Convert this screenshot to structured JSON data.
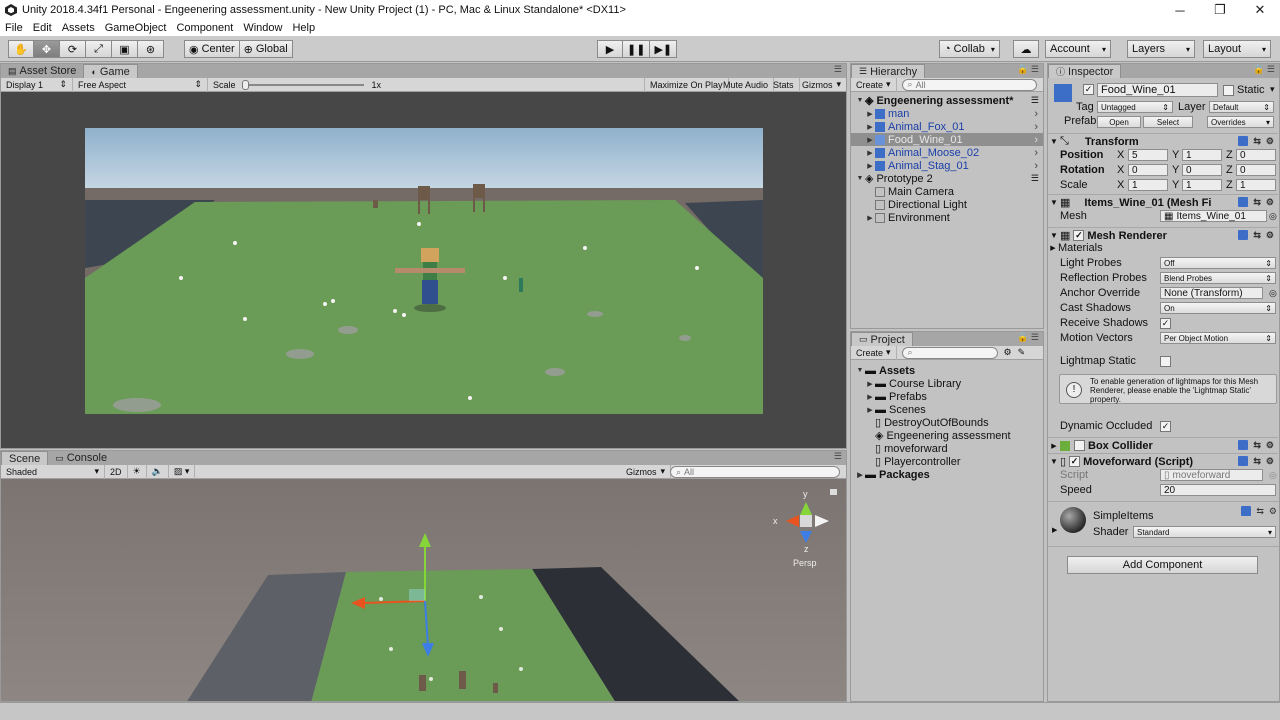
{
  "window": {
    "title": "Unity 2018.4.34f1 Personal - Engeenering assessment.unity - New Unity Project (1) - PC, Mac & Linux Standalone* <DX11>",
    "minimize": "─",
    "maximize": "❐",
    "close": "✕"
  },
  "menu": [
    "File",
    "Edit",
    "Assets",
    "GameObject",
    "Component",
    "Window",
    "Help"
  ],
  "toolbar": {
    "center_label": "Center",
    "global_label": "Global",
    "collab_label": "Collab",
    "account_label": "Account",
    "layers_label": "Layers",
    "layout_label": "Layout"
  },
  "game_panel": {
    "tabs": [
      "Asset Store",
      "Game"
    ],
    "display": "Display 1",
    "aspect": "Free Aspect",
    "scale_label": "Scale",
    "scale_value": "1x",
    "maximize_on_play": "Maximize On Play",
    "mute_audio": "Mute Audio",
    "stats": "Stats",
    "gizmos": "Gizmos"
  },
  "scene_panel": {
    "tabs": [
      "Scene",
      "Console"
    ],
    "shading": "Shaded",
    "mode_2d": "2D",
    "gizmos": "Gizmos",
    "search_placeholder": "All",
    "persp_label": "Persp",
    "axis_x": "x",
    "axis_y": "y",
    "axis_z": "z"
  },
  "hierarchy": {
    "tab": "Hierarchy",
    "create": "Create",
    "search_placeholder": "All",
    "scenes": [
      {
        "name": "Engeenering assessment*",
        "items": [
          "man",
          "Animal_Fox_01",
          "Food_Wine_01",
          "Animal_Moose_02",
          "Animal_Stag_01"
        ],
        "selected": "Food_Wine_01"
      },
      {
        "name": "Prototype 2",
        "items": [
          "Main Camera",
          "Directional Light",
          "Environment"
        ]
      }
    ]
  },
  "project": {
    "tab": "Project",
    "create": "Create",
    "assets_label": "Assets",
    "items": [
      "Course Library",
      "Prefabs",
      "Scenes",
      "DestroyOutOfBounds",
      "Engeenering assessment",
      "moveforward",
      "Playercontroller"
    ],
    "packages_label": "Packages"
  },
  "inspector": {
    "tab": "Inspector",
    "object_name": "Food_Wine_01",
    "static_label": "Static",
    "tag_label": "Tag",
    "tag_value": "Untagged",
    "layer_label": "Layer",
    "layer_value": "Default",
    "prefab_label": "Prefab",
    "open_label": "Open",
    "select_label": "Select",
    "overrides_label": "Overrides",
    "transform": {
      "title": "Transform",
      "position_label": "Position",
      "rotation_label": "Rotation",
      "scale_label": "Scale",
      "x": "X",
      "y": "Y",
      "z": "Z",
      "position": [
        "5",
        "1",
        "0"
      ],
      "rotation": [
        "0",
        "0",
        "0"
      ],
      "scale": [
        "1",
        "1",
        "1"
      ]
    },
    "mesh_filter": {
      "title": "Items_Wine_01 (Mesh Fi",
      "mesh_label": "Mesh",
      "mesh_value": "Items_Wine_01"
    },
    "mesh_renderer": {
      "title": "Mesh Renderer",
      "materials_label": "Materials",
      "light_probes_label": "Light Probes",
      "light_probes_value": "Off",
      "reflection_probes_label": "Reflection Probes",
      "reflection_probes_value": "Blend Probes",
      "anchor_override_label": "Anchor Override",
      "anchor_override_value": "None (Transform)",
      "cast_shadows_label": "Cast Shadows",
      "cast_shadows_value": "On",
      "receive_shadows_label": "Receive Shadows",
      "motion_vectors_label": "Motion Vectors",
      "motion_vectors_value": "Per Object Motion",
      "lightmap_static_label": "Lightmap Static",
      "info_text": "To enable generation of lightmaps for this Mesh Renderer, please enable the 'Lightmap Static' property.",
      "dynamic_occluded_label": "Dynamic Occluded"
    },
    "box_collider": {
      "title": "Box Collider"
    },
    "moveforward": {
      "title": "Moveforward (Script)",
      "script_label": "Script",
      "script_value": "moveforward",
      "speed_label": "Speed",
      "speed_value": "20"
    },
    "material": {
      "name": "SimpleItems",
      "shader_label": "Shader",
      "shader_value": "Standard"
    },
    "add_component": "Add Component"
  },
  "colors": {
    "selection": "#8f8f8f",
    "link_blue": "#1a3fa8",
    "ground_green": "#6a9b57",
    "sky_top": "#8fb1cc"
  }
}
